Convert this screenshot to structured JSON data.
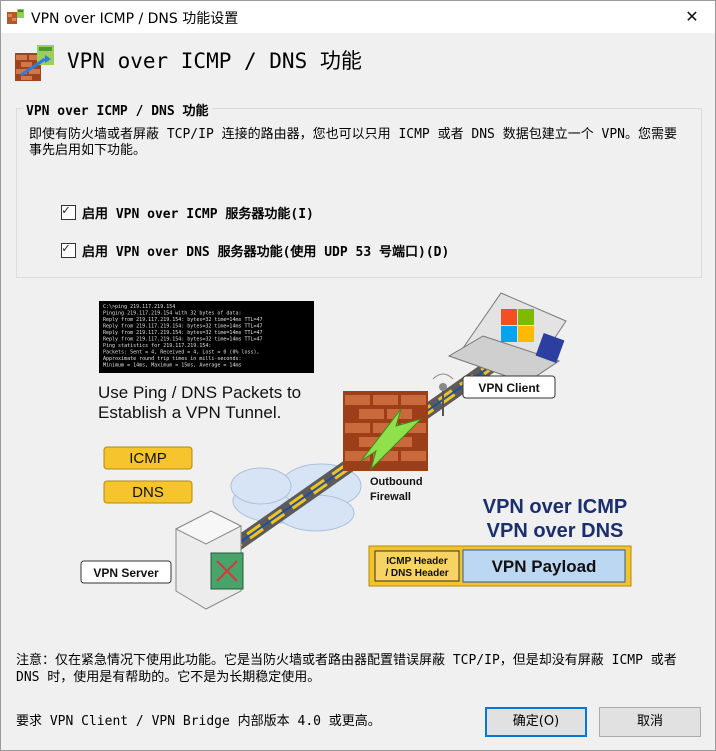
{
  "window": {
    "title": "VPN over ICMP / DNS 功能设置",
    "close_glyph": "✕"
  },
  "header": {
    "title": "VPN over ICMP / DNS 功能"
  },
  "group": {
    "legend": "VPN over ICMP / DNS 功能",
    "description": "即使有防火墙或者屏蔽 TCP/IP 连接的路由器，您也可以只用 ICMP 或者 DNS 数据包建立一个 VPN。您需要事先启用如下功能。",
    "checkbox_icmp": {
      "label": "启用 VPN over ICMP 服务器功能(I)",
      "checked": true
    },
    "checkbox_dns": {
      "label": "启用 VPN over DNS 服务器功能(使用 UDP 53 号端口)(D)",
      "checked": true
    }
  },
  "illustration": {
    "terminal_lines": [
      "C:\\>ping 219.117.219.154",
      "Pinging 219.117.219.154 with 32 bytes of data:",
      "Reply from 219.117.219.154: bytes=32 time=14ms TTL=47",
      "Reply from 219.117.219.154: bytes=32 time=14ms TTL=47",
      "Reply from 219.117.219.154: bytes=32 time=14ms TTL=47",
      "Reply from 219.117.219.154: bytes=32 time=14ms TTL=47",
      "Ping statistics for 219.117.219.154:",
      "    Packets: Sent = 4, Received = 4, Lost = 0 (0% loss),",
      "Approximate round trip times in milli-seconds:",
      "    Minimum = 14ms, Maximum = 15ms, Average = 14ms"
    ],
    "caption_line1": "Use Ping / DNS Packets to",
    "caption_line2": "Establish a VPN Tunnel.",
    "badge_icmp": "ICMP",
    "badge_dns": "DNS",
    "vpn_client": "VPN Client",
    "vpn_server": "VPN Server",
    "firewall_line1": "Outbound",
    "firewall_line2": "Firewall",
    "title_icmp": "VPN over ICMP",
    "title_dns": "VPN over DNS",
    "header_box_line1": "ICMP Header",
    "header_box_line2": "/ DNS Header",
    "payload": "VPN Payload"
  },
  "note": "注意：仅在紧急情况下使用此功能。它是当防火墙或者路由器配置错误屏蔽 TCP/IP，但是却没有屏蔽 ICMP 或者 DNS 时，使用是有帮助的。它不是为长期稳定使用。",
  "requirement": "要求 VPN Client / VPN Bridge 内部版本 4.0 或更高。",
  "buttons": {
    "ok": "确定(O)",
    "cancel": "取消"
  }
}
